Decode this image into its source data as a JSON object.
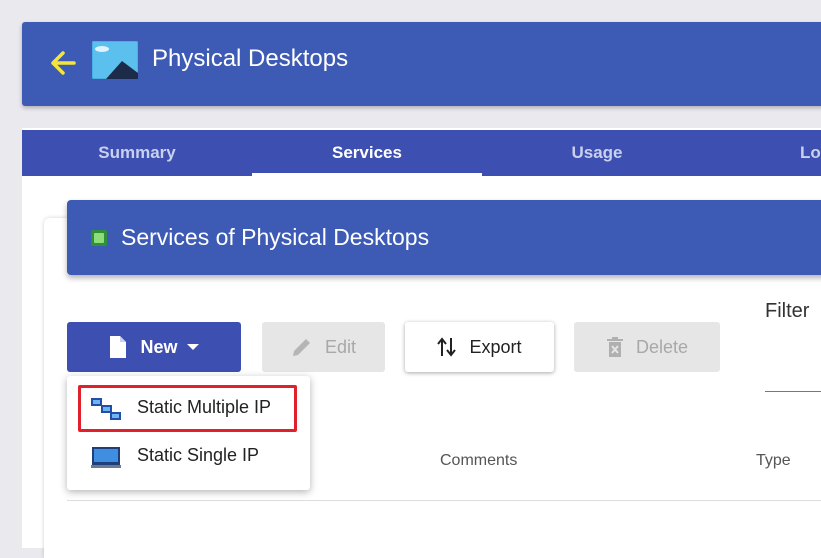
{
  "header": {
    "title": "Physical Desktops"
  },
  "tabs": [
    {
      "label": "Summary"
    },
    {
      "label": "Services"
    },
    {
      "label": "Usage"
    },
    {
      "label": "Lo"
    }
  ],
  "card": {
    "title": "Services of Physical Desktops"
  },
  "toolbar": {
    "new_label": "New",
    "edit_label": "Edit",
    "export_label": "Export",
    "delete_label": "Delete"
  },
  "filter": {
    "label": "Filter"
  },
  "new_menu": {
    "items": [
      {
        "label": "Static Multiple IP",
        "icon": "multiple-ip-icon"
      },
      {
        "label": "Static Single IP",
        "icon": "single-ip-icon"
      }
    ]
  },
  "table": {
    "columns": [
      "Comments",
      "Type"
    ]
  },
  "colors": {
    "primary": "#3d5bb5",
    "tab_bar": "#3d4fb0",
    "back_arrow": "#f5e53b",
    "highlight": "#e0202a"
  }
}
